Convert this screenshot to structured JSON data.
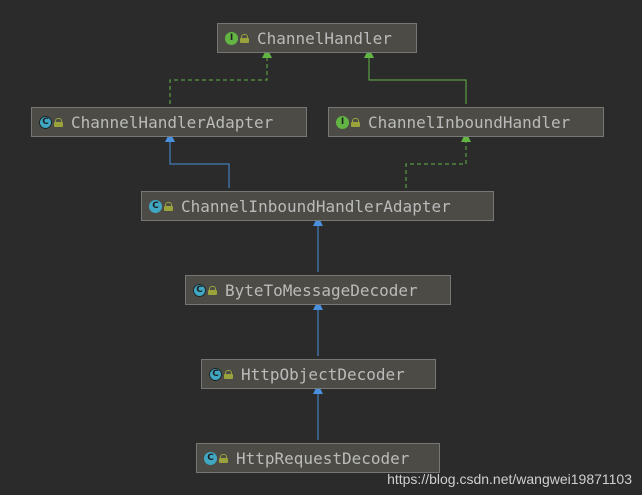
{
  "nodes": {
    "channel_handler": {
      "name": "ChannelHandler",
      "kind": "interface",
      "badge": "I"
    },
    "channel_handler_adapter": {
      "name": "ChannelHandlerAdapter",
      "kind": "abstract-class",
      "badge": "C"
    },
    "channel_inbound_handler": {
      "name": "ChannelInboundHandler",
      "kind": "interface",
      "badge": "I"
    },
    "channel_inbound_handler_adapter": {
      "name": "ChannelInboundHandlerAdapter",
      "kind": "class",
      "badge": "C"
    },
    "byte_to_message_decoder": {
      "name": "ByteToMessageDecoder",
      "kind": "abstract-class",
      "badge": "C"
    },
    "http_object_decoder": {
      "name": "HttpObjectDecoder",
      "kind": "abstract-class",
      "badge": "C"
    },
    "http_request_decoder": {
      "name": "HttpRequestDecoder",
      "kind": "class",
      "badge": "C"
    }
  },
  "edges": [
    {
      "from": "channel_handler_adapter",
      "to": "channel_handler",
      "relation": "implements"
    },
    {
      "from": "channel_inbound_handler",
      "to": "channel_handler",
      "relation": "extends"
    },
    {
      "from": "channel_inbound_handler_adapter",
      "to": "channel_handler_adapter",
      "relation": "extends"
    },
    {
      "from": "channel_inbound_handler_adapter",
      "to": "channel_inbound_handler",
      "relation": "implements"
    },
    {
      "from": "byte_to_message_decoder",
      "to": "channel_inbound_handler_adapter",
      "relation": "extends"
    },
    {
      "from": "http_object_decoder",
      "to": "byte_to_message_decoder",
      "relation": "extends"
    },
    {
      "from": "http_request_decoder",
      "to": "http_object_decoder",
      "relation": "extends"
    }
  ],
  "colors": {
    "background": "#2b2b2b",
    "extends_class": "#4a8fdc",
    "interface_relation": "#62b543"
  },
  "watermark": "https://blog.csdn.net/wangwei19871103"
}
